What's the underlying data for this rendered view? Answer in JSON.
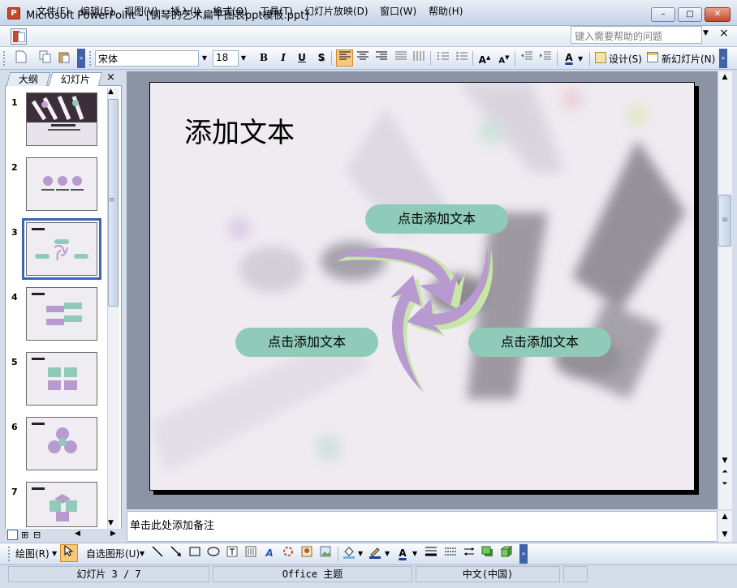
{
  "window": {
    "app_icon_letter": "P",
    "title": "Microsoft PowerPoint - [钢琴的艺术扁平图表ppt模板.ppt]",
    "minimize": "–",
    "restore": "□",
    "close": "✕"
  },
  "menu": {
    "items": [
      "文件(F)",
      "编辑(E)",
      "视图(V)",
      "插入(I)",
      "格式(O)",
      "工具(T)",
      "幻灯片放映(D)",
      "窗口(W)",
      "帮助(H)"
    ],
    "help_placeholder": "键入需要帮助的问题",
    "close_doc": "×"
  },
  "toolbar": {
    "font_name": "宋体",
    "font_size": "18",
    "bold": "B",
    "italic": "I",
    "underline": "U",
    "shadow": "S",
    "design_label": "设计(S)",
    "new_slide_label": "新幻灯片(N)"
  },
  "left_pane": {
    "tabs": [
      "大纲",
      "幻灯片"
    ],
    "selected_tab": "幻灯片",
    "close": "×",
    "thumbnail_numbers": [
      "1",
      "2",
      "3",
      "4",
      "5",
      "6",
      "7"
    ],
    "selected_slide": 3
  },
  "slide": {
    "title": "添加文本",
    "text_boxes": [
      "点击添加文本",
      "点击添加文本",
      "点击添加文本"
    ],
    "colors": {
      "pill": "#8fcbb8",
      "arrow_purple": "#b89ad0",
      "arrow_green": "#c8e6a8",
      "background": "#eeeaf0"
    }
  },
  "notes": {
    "placeholder": "单击此处添加备注"
  },
  "drawing_toolbar": {
    "draw_label": "绘图(R)",
    "autoshape_label": "自选图形(U)"
  },
  "status": {
    "slide_position": "幻灯片 3 / 7",
    "theme": "Office 主题",
    "language": "中文(中国)"
  }
}
